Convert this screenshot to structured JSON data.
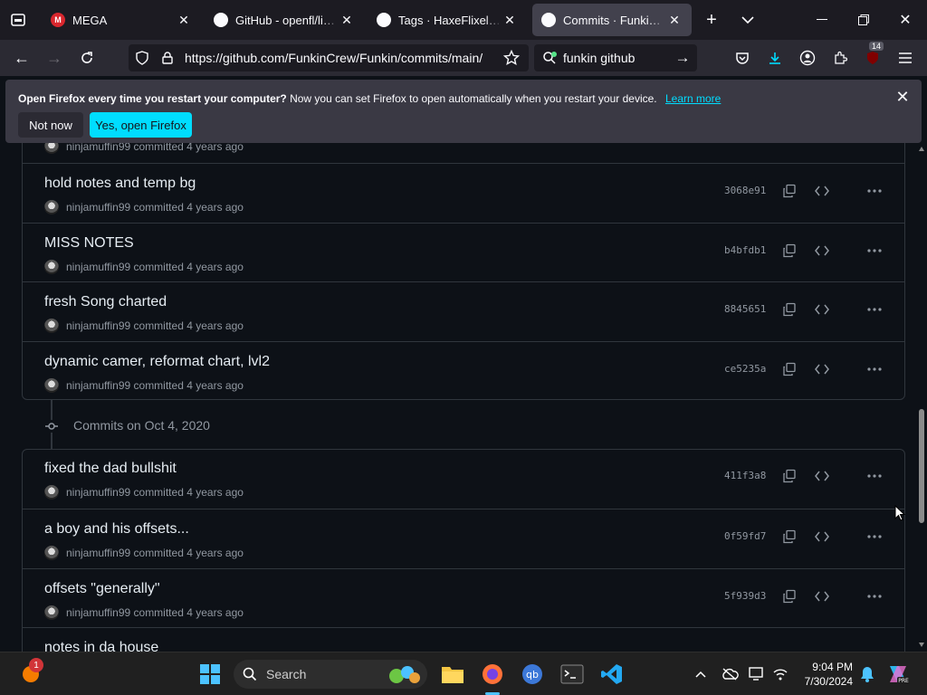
{
  "tabs": [
    {
      "title": "MEGA",
      "active": false
    },
    {
      "title": "GitHub - openfl/lime: A",
      "active": false
    },
    {
      "title": "Tags · HaxeFlixel/flixel",
      "active": false
    },
    {
      "title": "Commits · FunkinCrew/",
      "active": true
    }
  ],
  "nav": {
    "url": "https://github.com/FunkinCrew/Funkin/commits/main/",
    "search_value": "funkin github",
    "extension_badge": "14"
  },
  "notice": {
    "bold": "Open Firefox every time you restart your computer?",
    "text": " Now you can set Firefox to open automatically when you restart your device.",
    "link": "Learn more",
    "not_now": "Not now",
    "yes": "Yes, open Firefox"
  },
  "partial_top_meta": "ninjamuffin99 committed 4 years ago",
  "commits_group1": [
    {
      "message": "hold notes and temp bg",
      "author": "ninjamuffin99",
      "action": "committed",
      "when": "4 years ago",
      "sha": "3068e91"
    },
    {
      "message": "MISS NOTES",
      "author": "ninjamuffin99",
      "action": "committed",
      "when": "4 years ago",
      "sha": "b4bfdb1"
    },
    {
      "message": "fresh Song charted",
      "author": "ninjamuffin99",
      "action": "committed",
      "when": "4 years ago",
      "sha": "8845651"
    },
    {
      "message": "dynamic camer, reformat chart, lvl2",
      "author": "ninjamuffin99",
      "action": "committed",
      "when": "4 years ago",
      "sha": "ce5235a"
    }
  ],
  "group2_heading": "Commits on Oct 4, 2020",
  "commits_group2": [
    {
      "message": "fixed the dad bullshit",
      "author": "ninjamuffin99",
      "action": "committed",
      "when": "4 years ago",
      "sha": "411f3a8"
    },
    {
      "message": "a boy and his offsets...",
      "author": "ninjamuffin99",
      "action": "committed",
      "when": "4 years ago",
      "sha": "0f59fd7"
    },
    {
      "message": "offsets \"generally\"",
      "author": "ninjamuffin99",
      "action": "committed",
      "when": "4 years ago",
      "sha": "5f939d3"
    },
    {
      "message": "notes in da house",
      "author": "",
      "action": "",
      "when": "",
      "sha": ""
    }
  ],
  "taskbar": {
    "search_placeholder": "Search",
    "time": "9:04 PM",
    "date": "7/30/2024",
    "notif_badge": "1"
  },
  "colors": {
    "accent": "#00ddff",
    "link": "#00ddff",
    "bg": "#0d1117"
  }
}
